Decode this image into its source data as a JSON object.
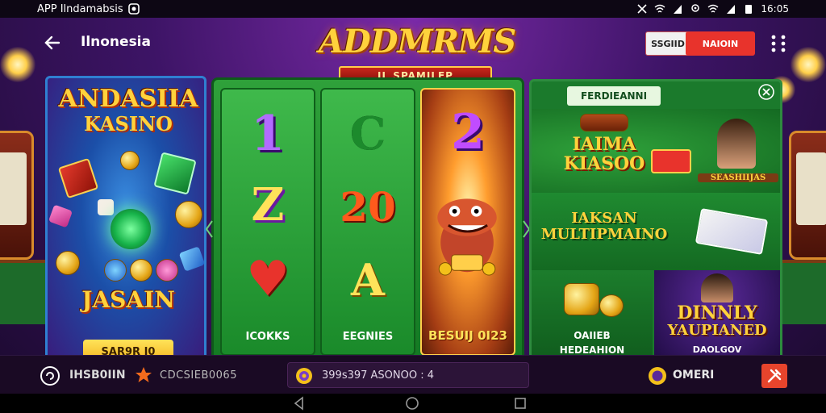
{
  "status_bar": {
    "app_label": "APP Ilndamabsis",
    "time": "16:05"
  },
  "header": {
    "back_icon": "arrow-left-icon",
    "location": "Ilnonesia",
    "brand_title": "ADDMRMS",
    "brand_ribbon": "IL SPAMILEP",
    "action_1": "SSGIID",
    "action_2": "NAIOIN",
    "menu_icon": "dots-grid-icon"
  },
  "left_panel": {
    "title_1": "ANDASIIA",
    "title_2": "KASINO",
    "title_3": "JASAIN",
    "cta_label": "SAR9R I0"
  },
  "reels": [
    {
      "symbol": "1",
      "symbol_2": "Z",
      "symbol_3": "♥",
      "caption": "ICOKKS"
    },
    {
      "symbol": "C",
      "symbol_2": "20",
      "symbol_3": "A",
      "caption": "EEGNIES"
    },
    {
      "symbol": "2",
      "caption": "BESUIJ 0I23"
    }
  ],
  "grid": {
    "header": "FERDIEANNI",
    "tile_1": "IAIMA KIASOO",
    "tile_1_badge": "SEASHIIJAS",
    "tile_2": "IAKSAN MULTIPMAINO",
    "tile_3_line_1": "OAIIEB",
    "tile_3_line_2": "HEDEAHION",
    "tile_4_line_1": "DINNLY",
    "tile_4_line_2": "YAUPIANED",
    "tile_4_line_3": "DAOLGOV"
  },
  "bottom_bar": {
    "left_label": "IHSB0IIN",
    "left_code": "CDCSIEB0065",
    "center_text": "399s397 ASONOO : 4",
    "right_label": "OMERI"
  },
  "colors": {
    "accent_gold": "#ffd23c",
    "accent_red": "#e8332c",
    "felt_green": "#1b7a2c",
    "background_purple": "#3d1466"
  }
}
